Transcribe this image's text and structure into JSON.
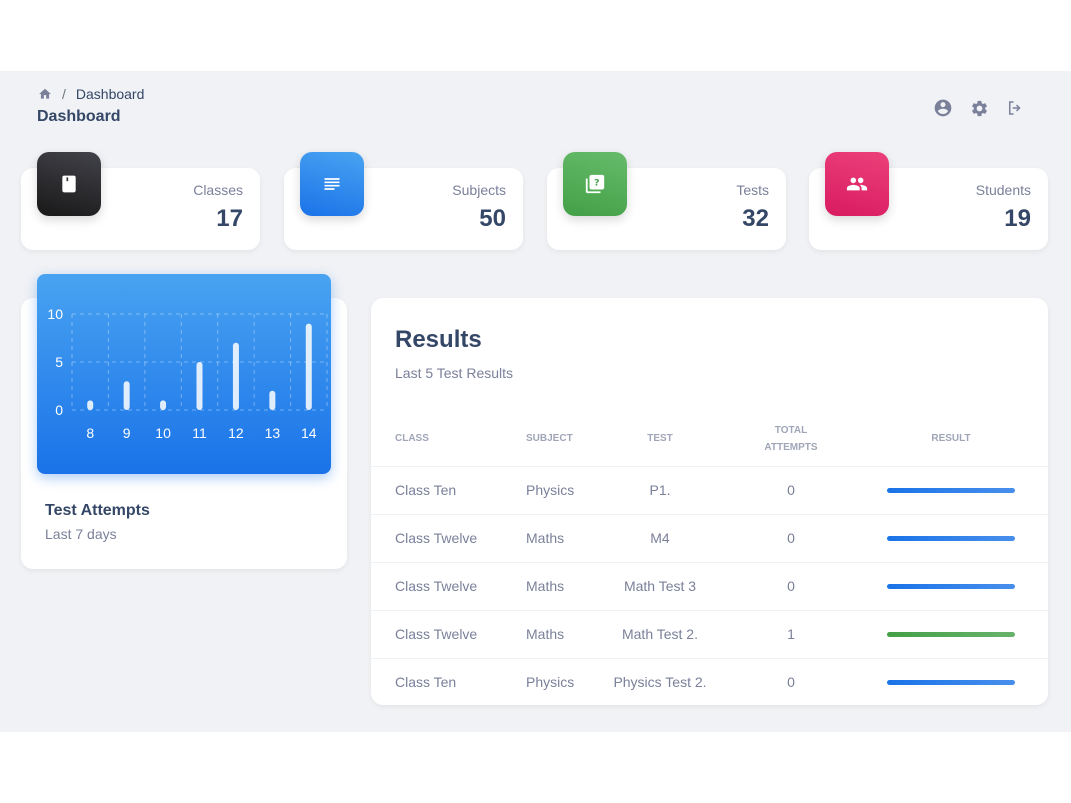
{
  "breadcrumb": {
    "current": "Dashboard"
  },
  "page_title": "Dashboard",
  "stats": [
    {
      "label": "Classes",
      "value": "17",
      "icon": "book-icon",
      "color": "#2b2b2e"
    },
    {
      "label": "Subjects",
      "value": "50",
      "icon": "notes-icon",
      "color": "#1A73E8"
    },
    {
      "label": "Tests",
      "value": "32",
      "icon": "quiz-icon",
      "color": "#4CAF50"
    },
    {
      "label": "Students",
      "value": "19",
      "icon": "group-icon",
      "color": "#E91E63"
    }
  ],
  "chart_card": {
    "title": "Test Attempts",
    "subtitle": "Last 7 days"
  },
  "chart_data": {
    "type": "bar",
    "categories": [
      "8",
      "9",
      "10",
      "11",
      "12",
      "13",
      "14"
    ],
    "values": [
      1,
      3,
      1,
      5,
      7,
      2,
      9
    ],
    "yticks": [
      "0",
      "5",
      "10"
    ],
    "ylim": [
      0,
      10
    ],
    "grid": true
  },
  "results": {
    "title": "Results",
    "subtitle": "Last 5 Test Results",
    "headers": [
      "Class",
      "Subject",
      "Test",
      "Total Attempts",
      "Result"
    ],
    "rows": [
      {
        "class": "Class Ten",
        "subject": "Physics",
        "test": "P1.",
        "attempts": "0",
        "result_color": "#1A73E8"
      },
      {
        "class": "Class Twelve",
        "subject": "Maths",
        "test": "M4",
        "attempts": "0",
        "result_color": "#1A73E8"
      },
      {
        "class": "Class Twelve",
        "subject": "Maths",
        "test": "Math Test 3",
        "attempts": "0",
        "result_color": "#1A73E8"
      },
      {
        "class": "Class Twelve",
        "subject": "Maths",
        "test": "Math Test 2.",
        "attempts": "1",
        "result_color": "#43A047"
      },
      {
        "class": "Class Ten",
        "subject": "Physics",
        "test": "Physics Test 2.",
        "attempts": "0",
        "result_color": "#1A73E8"
      }
    ]
  },
  "icons": {
    "account": "account-circle-icon",
    "settings": "gear-icon",
    "logout": "logout-icon"
  }
}
